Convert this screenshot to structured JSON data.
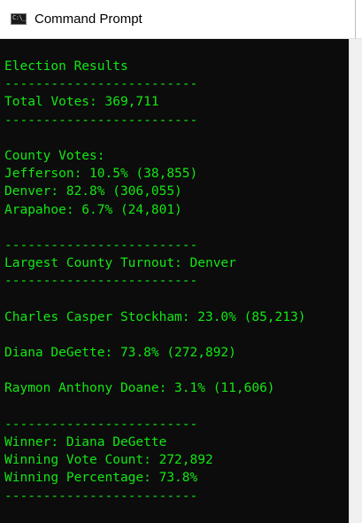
{
  "window": {
    "title": "Command Prompt",
    "icon": "console-app-icon",
    "icon_text": "C:\\_"
  },
  "colors": {
    "console_bg": "#0c0c0c",
    "console_text": "#13e713"
  },
  "console": {
    "lines": [
      "Election Results",
      "-------------------------",
      "Total Votes: 369,711",
      "-------------------------",
      "",
      "County Votes:",
      "Jefferson: 10.5% (38,855)",
      "Denver: 82.8% (306,055)",
      "Arapahoe: 6.7% (24,801)",
      "",
      "-------------------------",
      "Largest County Turnout: Denver",
      "-------------------------",
      "",
      "Charles Casper Stockham: 23.0% (85,213)",
      "",
      "Diana DeGette: 73.8% (272,892)",
      "",
      "Raymon Anthony Doane: 3.1% (11,606)",
      "",
      "-------------------------",
      "Winner: Diana DeGette",
      "Winning Vote Count: 272,892",
      "Winning Percentage: 73.8%",
      "-------------------------"
    ]
  }
}
